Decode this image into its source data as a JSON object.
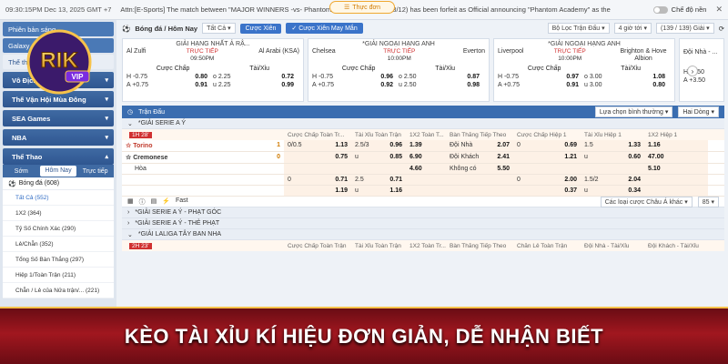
{
  "topbar": {
    "clock": "09:30:15PM Dec 13, 2025 GMT +7",
    "marquee": "Attn:[E-Sports] The match between \"MAJOR WINNERS -vs- Phantom Academy Series - 13/12) has been forfeit as Official announcing \"Phantom Academy\" as the",
    "menu_label": "Thực đơn",
    "toggle_label": "Chế độ nền"
  },
  "sidebar": {
    "buttons": [
      "Phiên bản sáng",
      "Galaxy",
      "Thể thao"
    ],
    "sections": [
      "Vô Địch Thế Giới",
      "Thế Vận Hội Mùa Đông",
      "SEA Games",
      "NBA",
      "Thể Thao"
    ],
    "tabs": [
      "Sớm",
      "Hôm Nay",
      "Trực tiếp"
    ],
    "category": "Bóng đá (608)",
    "items": [
      "Tất Cả (552)",
      "1X2 (364)",
      "Tỷ Số Chính Xác (290)",
      "Lẻ/Chẵn (352)",
      "Tổng Số Bàn Thắng (297)",
      "Hiệp 1/Toàn Trận (211)",
      "Chẵn / Lẻ của Nửa trận/... (221)"
    ]
  },
  "filterbar": {
    "breadcrumb": "Bóng đá / Hôm Nay",
    "select_all": "Tất Cả",
    "btn_xien": "Cược Xiên",
    "btn_xien_may": "Cược Xiên May Mắn",
    "sort": "Bộ Lọc Trận Đấu",
    "filter_time": "4 giờ tới",
    "count": "(139 / 139) Giải"
  },
  "cards": [
    {
      "league": "GIẢI HẠNG NHẤT Ả RẬ...",
      "home": "Al Zulfi",
      "away": "Al Arabi (KSA)",
      "live": "TRỰC TIẾP",
      "time": "09:50PM",
      "r1": [
        "H",
        "-0.75",
        "0.80",
        "o",
        "2.25",
        "0.72"
      ],
      "r2": [
        "A",
        "+0.75",
        "0.91",
        "u",
        "2.25",
        "0.99"
      ]
    },
    {
      "league": "*GIẢI NGOẠI HẠNG ANH",
      "home": "Chelsea",
      "away": "Everton",
      "live": "TRỰC TIẾP",
      "time": "10:00PM",
      "r1": [
        "H",
        "-0.75",
        "0.96",
        "o",
        "2.50",
        "0.87"
      ],
      "r2": [
        "A",
        "+0.75",
        "0.92",
        "u",
        "2.50",
        "0.98"
      ]
    },
    {
      "league": "*GIẢI NGOẠI HẠNG ANH",
      "home": "Liverpool",
      "away": "Brighton & Hove Albion",
      "live": "TRỰC TIẾP",
      "time": "10:00PM",
      "r1": [
        "H",
        "-0.75",
        "0.97",
        "o",
        "3.00",
        "1.08"
      ],
      "r2": [
        "A",
        "+0.75",
        "0.91",
        "u",
        "3.00",
        "0.80"
      ]
    },
    {
      "league": "",
      "home": "Đội Nhà - ...",
      "away": "",
      "live": "",
      "time": "",
      "r1": [
        "H",
        "-3.50",
        "",
        "",
        "",
        ""
      ],
      "r2": [
        "A",
        "+3.50",
        "",
        "",
        "",
        ""
      ]
    }
  ],
  "card_headers": {
    "hdp": "Cược Chấp",
    "ou": "Tài/Xỉu"
  },
  "match_header": {
    "title": "Trận Đấu",
    "view": "Lựa chọn bình thường",
    "sort": "Hai Dòng"
  },
  "league1": {
    "name": "*GIẢI SERIE A Ý",
    "time": "1H 28'"
  },
  "columns": [
    "Cược Chấp Toàn Tr...",
    "Tài Xỉu Toàn Trận",
    "1X2 Toàn T...",
    "Bàn Thắng Tiếp Theo",
    "Cược Chấp Hiệp 1",
    "Tài Xỉu Hiệp 1",
    "1X2 Hiệp 1"
  ],
  "match1": {
    "home": "Torino",
    "home_score": "1",
    "away": "Cremonese",
    "away_score": "0",
    "draw": "Hòa",
    "rows": [
      [
        "0/0.5",
        "1.13",
        "2.5/3",
        "0.96",
        "1.39",
        "Đội Nhà",
        "2.07",
        "0",
        "0.69",
        "1.5",
        "1.33",
        "1.16"
      ],
      [
        "",
        "0.75",
        "u",
        "0.85",
        "6.90",
        "Đội Khách",
        "2.41",
        "",
        "1.21",
        "u",
        "0.60",
        "47.00"
      ],
      [
        "",
        "",
        "",
        "",
        "4.60",
        "Không có",
        "5.50",
        "",
        "",
        "",
        "",
        "5.10"
      ],
      [
        "0",
        "0.71",
        "2.5",
        "0.71",
        "",
        "",
        "",
        "0",
        "2.00",
        "1.5/2",
        "2.04",
        ""
      ],
      [
        "",
        "1.19",
        "u",
        "1.16",
        "",
        "",
        "",
        "",
        "0.37",
        "u",
        "0.34",
        ""
      ]
    ]
  },
  "fast": "Fast",
  "other_filter": "Các loại cược Châu Á khác",
  "page_size": "85",
  "leagues": [
    "*GIẢI SERIE A Ý - PHẠT GÓC",
    "*GIẢI SERIE A Ý - THẺ PHẠT",
    "*GIẢI LALIGA TÂY BAN NHA"
  ],
  "league2_time": "2H 23'",
  "columns2": [
    "Cược Chấp Toàn Trận",
    "Tài Xỉu Toàn Trận",
    "1X2 Toàn Tr...",
    "Bàn Thắng Tiếp Theo",
    "Chẵn Lẻ Toàn Trận",
    "Đội Nhà - Tài/Xỉu",
    "Đội Khách - Tài/Xỉu"
  ],
  "banner": "KÈO TÀI XỈU KÍ HIỆU ĐƠN GIẢN, DỄ NHẬN BIẾT",
  "logo_text": "RIK VIP",
  "colors": {
    "primary": "#3a73c9",
    "live": "#d03030",
    "banner": "#a1171f",
    "accent": "#f6c24a"
  }
}
